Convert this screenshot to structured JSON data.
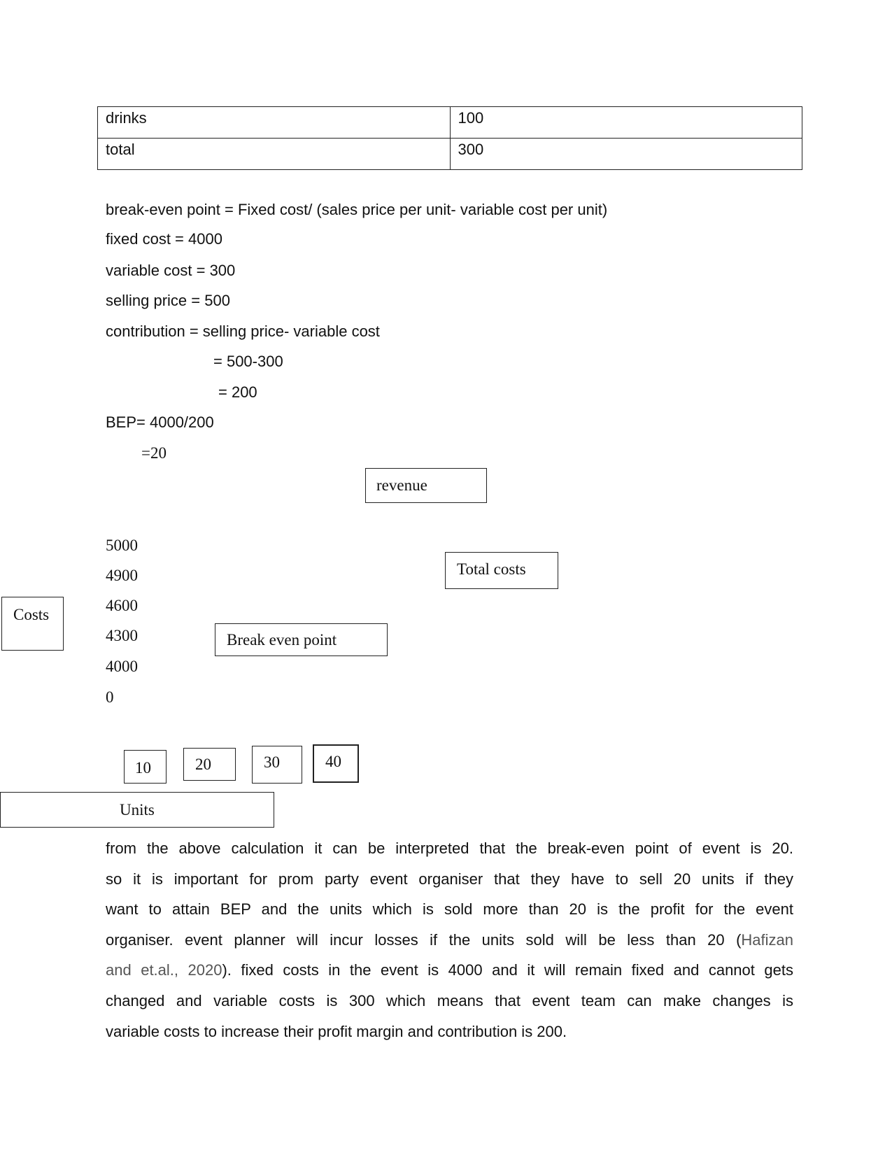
{
  "table": {
    "rows": [
      {
        "item": "drinks",
        "value": "100"
      },
      {
        "item": "total",
        "value": "300"
      }
    ]
  },
  "calc": {
    "formula": "break-even point = Fixed cost/ (sales price per unit- variable cost per unit)",
    "fixed_cost": "fixed cost = 4000",
    "variable_cost": "variable cost = 300",
    "selling_price": "selling price = 500",
    "contribution": "contribution = selling price- variable cost",
    "contribution_step": "= 500-300",
    "contribution_result": "= 200",
    "bep": "BEP= 4000/200",
    "bep_result": "=20"
  },
  "diagram": {
    "revenue_label": "revenue",
    "total_costs_label": "Total costs",
    "costs_label": "Costs",
    "break_even_label": "Break even point",
    "units_label": "Units",
    "y_ticks": [
      "5000",
      "4900",
      "4600",
      "4300",
      "4000",
      "0"
    ],
    "x_ticks": [
      "10",
      "20",
      "30",
      "40"
    ]
  },
  "paragraph": {
    "lines": [
      "from the above calculation it can be interpreted that the break-even point of event is 20.",
      "so it is important for prom party event organiser that they have to sell 20 units if they",
      "want to attain BEP and the units which is sold more than 20 is the profit for the event",
      "organiser. event planner will incur losses if the units sold will be less than 20 (",
      "). fixed costs in the event is 4000 and it will remain fixed and cannot gets",
      "changed and variable costs is 300 which means that event team can make changes is",
      "variable costs to increase their profit margin and contribution is 200."
    ],
    "citation_part1": "Hafizan",
    "citation_part2": "and et.al., 2020"
  }
}
